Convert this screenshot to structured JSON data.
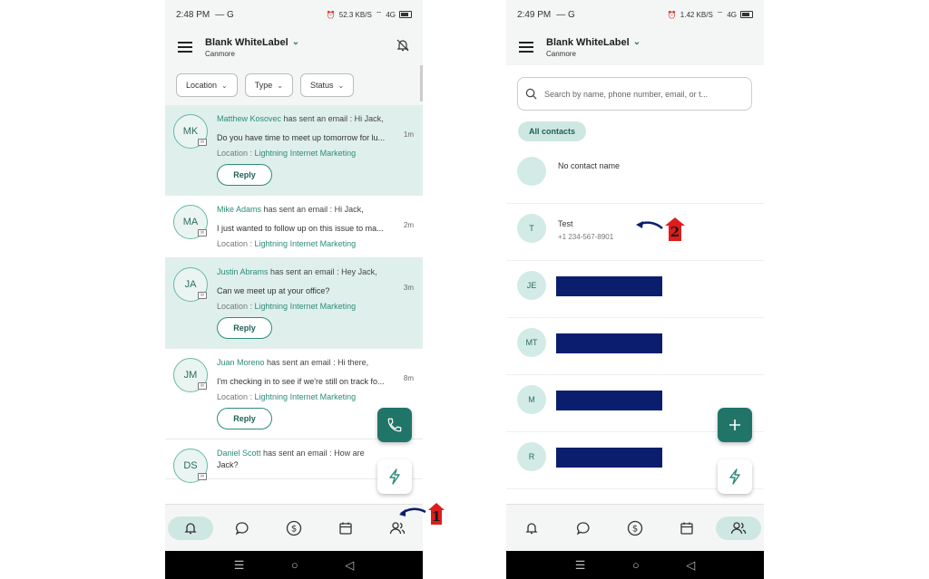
{
  "left_screen": {
    "status": {
      "time": "2:48 PM",
      "extra": "— G",
      "network": "52.3 KB/S",
      "signal": "4G"
    },
    "header": {
      "account_name": "Blank WhiteLabel",
      "location": "Canmore"
    },
    "filters": [
      "Location",
      "Type",
      "Status"
    ],
    "feed": [
      {
        "initials": "MK",
        "name": "Matthew Kosovec",
        "action": " has sent an email : Hi Jack,",
        "time": "1m",
        "body": "Do you have time to meet up tomorrow for lu...",
        "location_label": "Location : ",
        "location": "Lightning Internet Marketing",
        "reply": "Reply"
      },
      {
        "initials": "MA",
        "name": "Mike Adams",
        "action": " has sent an email : Hi Jack,",
        "time": "2m",
        "body": "I just wanted to follow up on this issue to ma...",
        "location_label": "Location : ",
        "location": "Lightning Internet Marketing",
        "reply": ""
      },
      {
        "initials": "JA",
        "name": "Justin Abrams",
        "action": " has sent an email : Hey Jack,",
        "time": "3m",
        "body": "Can we meet up at your office?",
        "location_label": "Location : ",
        "location": "Lightning Internet Marketing",
        "reply": "Reply"
      },
      {
        "initials": "JM",
        "name": "Juan Moreno",
        "action": " has sent an email : Hi there,",
        "time": "8m",
        "body": "I'm checking in to see if we're still on track fo...",
        "location_label": "Location : ",
        "location": "Lightning Internet Marketing",
        "reply": "Reply"
      },
      {
        "initials": "DS",
        "name": "Daniel Scott",
        "action": " has sent an email : How are",
        "time": "",
        "body": "Jack?",
        "location_label": "",
        "location": "",
        "reply": ""
      }
    ],
    "annotation_number": "1"
  },
  "right_screen": {
    "status": {
      "time": "2:49 PM",
      "extra": "— G",
      "network": "1.42 KB/S",
      "signal": "4G"
    },
    "header": {
      "account_name": "Blank WhiteLabel",
      "location": "Canmore"
    },
    "search_placeholder": "Search by name, phone number, email, or t...",
    "chip_label": "All contacts",
    "contacts": [
      {
        "initials": "",
        "name": "No contact name",
        "phone": "",
        "redacted": false
      },
      {
        "initials": "T",
        "name": "Test",
        "phone": "+1 234-567-8901",
        "redacted": false
      },
      {
        "initials": "JE",
        "name": "",
        "phone": "",
        "redacted": true
      },
      {
        "initials": "MT",
        "name": "",
        "phone": "",
        "redacted": true
      },
      {
        "initials": "M",
        "name": "",
        "phone": "",
        "redacted": true
      },
      {
        "initials": "R",
        "name": "",
        "phone": "",
        "redacted": true
      }
    ],
    "annotation_number": "2"
  },
  "icons": {
    "menu": "menu-icon",
    "bell_off": "bell-off-icon",
    "search": "search-icon",
    "phone": "phone-icon",
    "bolt": "bolt-icon",
    "plus": "plus-icon",
    "nav": [
      "bell-icon",
      "chat-icon",
      "dollar-icon",
      "calendar-icon",
      "contacts-icon"
    ]
  },
  "colors": {
    "accent": "#217568",
    "highlight": "#dff0ec",
    "chip": "#cfe7e2",
    "annotation_red": "#e01c1c",
    "annotation_arrow": "#0b1e6e"
  }
}
